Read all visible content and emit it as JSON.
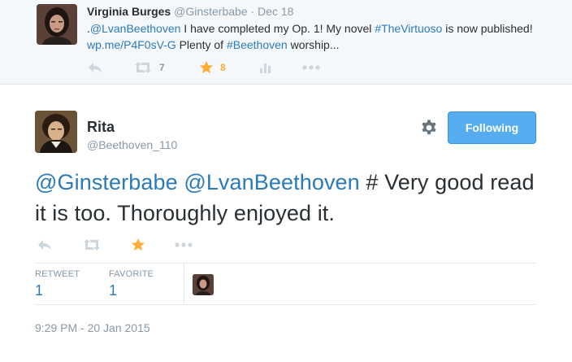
{
  "context_tweet": {
    "name": "Virginia Burges",
    "handle": "@Ginsterbabe",
    "separator": "·",
    "date": "Dec 18",
    "text_parts": [
      {
        "text": ".",
        "type": "text"
      },
      {
        "text": "@LvanBeethoven",
        "type": "link"
      },
      {
        "text": " I have completed my Op. 1! My novel ",
        "type": "text"
      },
      {
        "text": "#TheVirtuoso",
        "type": "link"
      },
      {
        "text": " is now published! ",
        "type": "text"
      },
      {
        "text": "wp.me/P4F0sV-G",
        "type": "link"
      },
      {
        "text": " Plenty of ",
        "type": "text"
      },
      {
        "text": "#Beethoven",
        "type": "link"
      },
      {
        "text": " worship...",
        "type": "text"
      }
    ],
    "retweet_count": "7",
    "favorite_count": "8"
  },
  "main_tweet": {
    "name": "Rita",
    "handle": "@Beethoven_110",
    "follow_label": "Following",
    "text_parts": [
      {
        "text": "@Ginsterbabe",
        "type": "link"
      },
      {
        "text": " ",
        "type": "text"
      },
      {
        "text": "@LvanBeethoven",
        "type": "link"
      },
      {
        "text": " # Very good read it is too. Thoroughly enjoyed it.",
        "type": "text"
      }
    ],
    "stats": {
      "retweet_label": "RETWEET",
      "retweet_value": "1",
      "favorite_label": "FAVORITE",
      "favorite_value": "1"
    },
    "timestamp": "9:29 PM - 20 Jan 2015"
  },
  "colors": {
    "link": "#2b7bb9",
    "muted": "#8899a6",
    "favorite_active": "#ffac33",
    "follow_button": "#55acee"
  },
  "icons": [
    "reply-icon",
    "retweet-icon",
    "favorite-icon",
    "analytics-icon",
    "more-icon",
    "gear-icon"
  ]
}
